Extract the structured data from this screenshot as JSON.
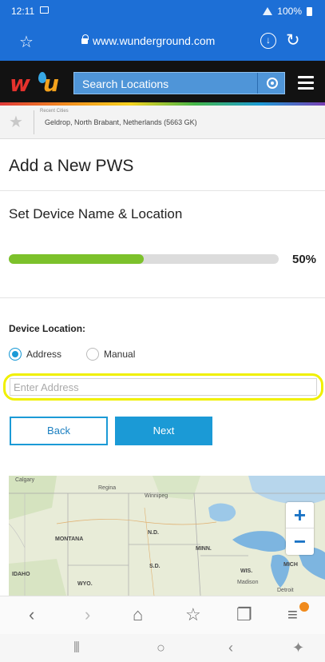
{
  "status_bar": {
    "time": "12:11",
    "battery": "100%"
  },
  "browser": {
    "url": "www.wunderground.com"
  },
  "header": {
    "search_placeholder": "Search Locations"
  },
  "recent_cities": {
    "label": "Recent Cities",
    "city": "Geldrop, North Brabant, Netherlands (5663 GK)"
  },
  "page": {
    "title": "Add a New PWS",
    "step_title": "Set Device Name & Location",
    "progress": 0.5,
    "progress_label": "50%"
  },
  "form": {
    "device_location_label": "Device Location:",
    "options": [
      "Address",
      "Manual"
    ],
    "selected_option": "Address",
    "address_placeholder": "Enter Address",
    "address_value": ""
  },
  "buttons": {
    "back": "Back",
    "next": "Next"
  },
  "map": {
    "labels": {
      "calgary": "Calgary",
      "regina": "Regina",
      "winnipeg": "Winnipeg",
      "montana": "MONTANA",
      "nd": "N.D.",
      "minn": "MINN.",
      "idaho": "IDAHO",
      "wyo": "WYO.",
      "sd": "S.D.",
      "wis": "WIS.",
      "madison": "Madison",
      "mich": "MICH",
      "detroit": "Detroit"
    },
    "zoom_in": "+",
    "zoom_out": "−"
  },
  "colors": {
    "brand_blue": "#1d6fd6",
    "accent": "#1b9ad6",
    "progress": "#7cc12b",
    "highlight": "#f0f000"
  }
}
